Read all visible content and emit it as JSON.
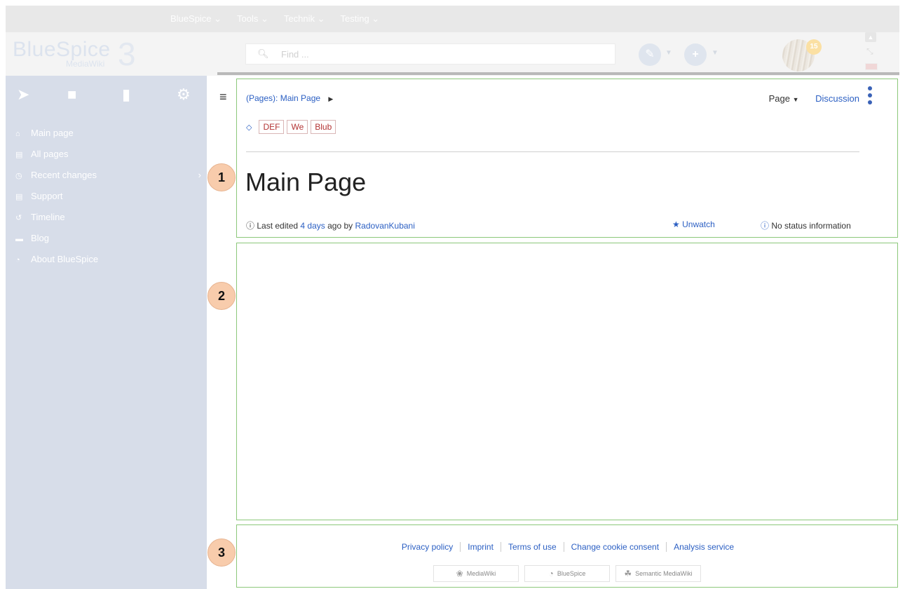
{
  "topnav": {
    "items": [
      "BlueSpice ⌄",
      "Tools ⌄",
      "Technik ⌄",
      "Testing ⌄"
    ]
  },
  "logo": {
    "brand": "BlueSpice",
    "sub": "MediaWiki",
    "version": "3"
  },
  "header": {
    "search_placeholder": "Find ...",
    "notification_count": "15",
    "edit_icon": "pencil-icon",
    "add_icon": "plus-icon"
  },
  "sidebar": {
    "tool_icons": [
      "navigation-icon",
      "book-icon",
      "clipboard-icon",
      "gear-icon"
    ],
    "items": [
      {
        "label": "Main page",
        "icon": "home-icon"
      },
      {
        "label": "All pages",
        "icon": "pages-icon"
      },
      {
        "label": "Recent changes",
        "icon": "clock-icon"
      },
      {
        "label": "Support",
        "icon": "document-icon"
      },
      {
        "label": "Timeline",
        "icon": "history-icon"
      },
      {
        "label": "Blog",
        "icon": "blog-icon"
      },
      {
        "label": "About BlueSpice",
        "icon": "info-icon"
      }
    ]
  },
  "content": {
    "breadcrumb_prefix": "(Pages):",
    "breadcrumb_page": "Main Page",
    "page_menu_label": "Page",
    "discussion_label": "Discussion",
    "tags": [
      "DEF",
      "We",
      "Blub"
    ],
    "title": "Main Page",
    "meta_prefix": "Last edited",
    "meta_time": "4 days",
    "meta_mid": "ago by",
    "meta_user": "RadovanKubani",
    "unwatch_label": "Unwatch",
    "status_label": "No status information"
  },
  "footer": {
    "links": [
      "Privacy policy",
      "Imprint",
      "Terms of use",
      "Change cookie consent",
      "Analysis service"
    ],
    "badges": [
      "MediaWiki",
      "BlueSpice",
      "Semantic MediaWiki"
    ]
  },
  "callouts": [
    "1",
    "2",
    "3"
  ],
  "colors": {
    "accent": "#2b5fc3",
    "sidebar_bg": "#d7dde9",
    "region_border": "#8cc87a",
    "callout_bg": "#f8ccac",
    "tag_text": "#b33333"
  }
}
